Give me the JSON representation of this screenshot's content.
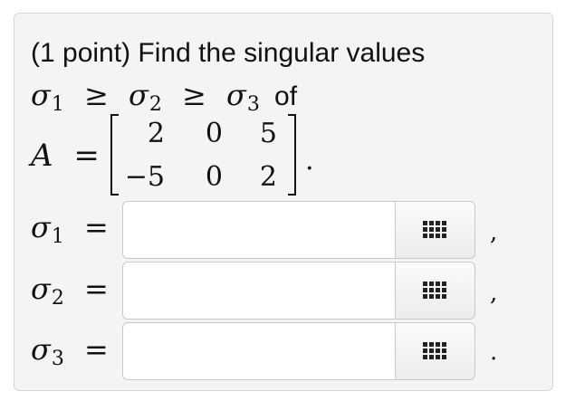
{
  "problem": {
    "prefix": "(1 point) Find the singular values",
    "sigma_symbol": "σ",
    "geq_symbol": "≥",
    "sub1": "1",
    "sub2": "2",
    "sub3": "3",
    "of_word": "of",
    "matrix_name": "A",
    "equals": "=",
    "matrix": {
      "r1c1": "2",
      "r1c2": "0",
      "r1c3": "5",
      "r2c1": "−5",
      "r2c2": "0",
      "r2c3": "2"
    },
    "matrix_end": "."
  },
  "answers": [
    {
      "label_symbol": "σ",
      "label_sub": "1",
      "equals": "=",
      "value": "",
      "trailing": ","
    },
    {
      "label_symbol": "σ",
      "label_sub": "2",
      "equals": "=",
      "value": "",
      "trailing": ","
    },
    {
      "label_symbol": "σ",
      "label_sub": "3",
      "equals": "=",
      "value": "",
      "trailing": "."
    }
  ],
  "palette_icon": "grid-palette-icon"
}
